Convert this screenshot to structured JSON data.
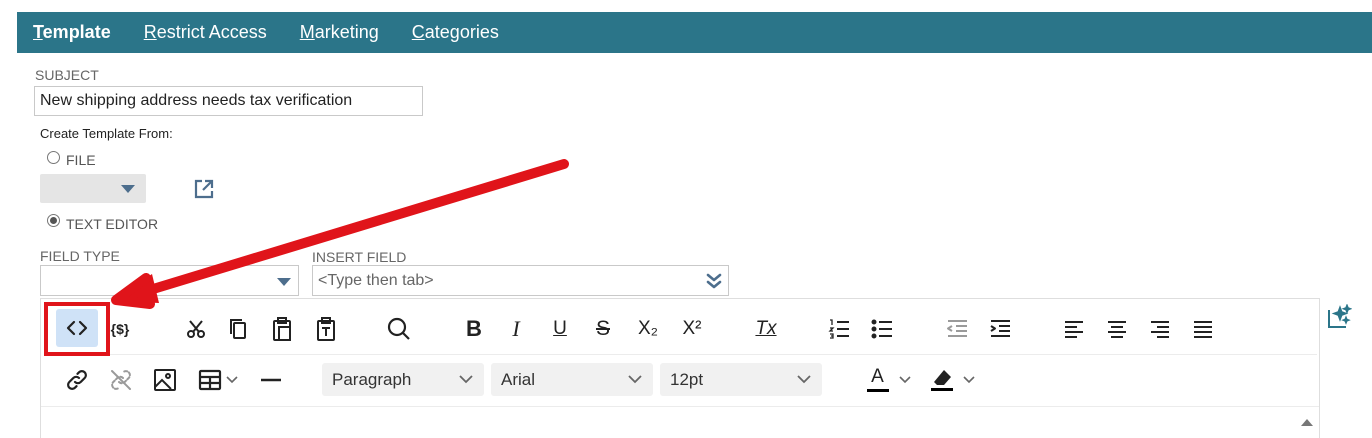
{
  "tabs": [
    {
      "label": "Template",
      "accel": "T",
      "rest": "emplate",
      "active": true
    },
    {
      "label": "Restrict Access",
      "accel": "R",
      "rest": "estrict Access",
      "active": false
    },
    {
      "label": "Marketing",
      "accel": "M",
      "rest": "arketing",
      "active": false
    },
    {
      "label": "Categories",
      "accel": "C",
      "rest": "ategories",
      "active": false
    }
  ],
  "subject": {
    "label": "SUBJECT",
    "value": "New shipping address needs tax verification"
  },
  "create_from": {
    "label": "Create Template From:",
    "file_label": "FILE",
    "text_editor_label": "TEXT EDITOR",
    "selected": "TEXT EDITOR"
  },
  "field_type": {
    "label": "FIELD TYPE",
    "value": ""
  },
  "insert_field": {
    "label": "INSERT FIELD",
    "placeholder": "<Type then tab>"
  },
  "toolbar": {
    "row1": [
      "source-code",
      "template-variable",
      "cut",
      "copy",
      "paste",
      "paste-as-text",
      "find",
      "bold",
      "italic",
      "underline",
      "strikethrough",
      "subscript",
      "superscript",
      "clear-formatting",
      "numbered-list",
      "bullet-list",
      "outdent",
      "indent",
      "align-left",
      "align-center",
      "align-right",
      "justify"
    ],
    "row2": [
      "link",
      "unlink",
      "image",
      "table",
      "horizontal-line",
      "block-format",
      "font-family",
      "font-size",
      "text-color",
      "highlight-color"
    ],
    "block_format": "Paragraph",
    "font_family": "Arial",
    "font_size": "12pt",
    "template_var_glyph": "{$}",
    "bold_glyph": "B",
    "italic_glyph": "I",
    "underline_glyph": "U",
    "strike_glyph": "S",
    "sub_glyph": "X₂",
    "sup_glyph": "X²",
    "clear_glyph": "Tx",
    "text_color_glyph": "A"
  },
  "colors": {
    "tab_bar": "#2b7589",
    "annotation_red": "#e0141a",
    "pressed": "#cfe2f7"
  }
}
